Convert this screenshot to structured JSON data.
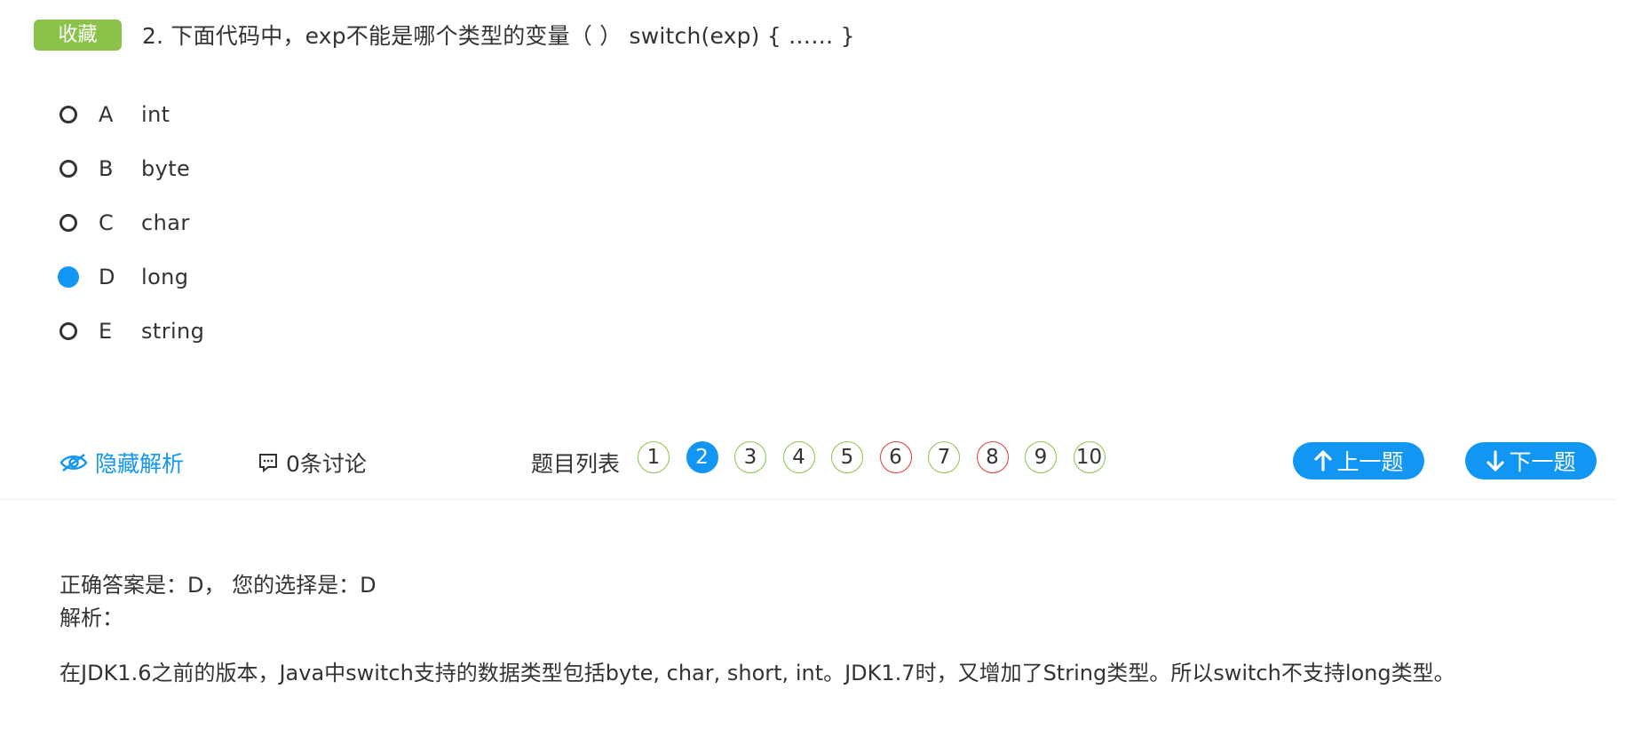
{
  "header": {
    "favorite_label": "收藏",
    "question_title": "2. 下面代码中，exp不能是哪个类型的变量（ ） switch(exp) { …… }"
  },
  "options": [
    {
      "letter": "A",
      "text": "int",
      "selected": false
    },
    {
      "letter": "B",
      "text": "byte",
      "selected": false
    },
    {
      "letter": "C",
      "text": "char",
      "selected": false
    },
    {
      "letter": "D",
      "text": "long",
      "selected": true
    },
    {
      "letter": "E",
      "text": "string",
      "selected": false
    }
  ],
  "toolbar": {
    "hide_analysis_label": "隐藏解析",
    "discussion_label": "0条讨论",
    "question_list_label": "题目列表",
    "question_numbers": [
      {
        "num": "1",
        "status": "correct"
      },
      {
        "num": "2",
        "status": "current"
      },
      {
        "num": "3",
        "status": "correct"
      },
      {
        "num": "4",
        "status": "correct"
      },
      {
        "num": "5",
        "status": "correct"
      },
      {
        "num": "6",
        "status": "wrong"
      },
      {
        "num": "7",
        "status": "correct"
      },
      {
        "num": "8",
        "status": "wrong"
      },
      {
        "num": "9",
        "status": "correct"
      },
      {
        "num": "10",
        "status": "correct"
      }
    ],
    "prev_label": "上一题",
    "next_label": "下一题"
  },
  "analysis": {
    "answer_line": "正确答案是：D， 您的选择是：D",
    "label": "解析：",
    "text": "在JDK1.6之前的版本，Java中switch支持的数据类型包括byte, char, short, int。JDK1.7时，又增加了String类型。所以switch不支持long类型。"
  },
  "colors": {
    "accent": "#1296f4",
    "favorite": "#8bc34a",
    "correct_border": "#8bc34a",
    "wrong_border": "#e53935"
  }
}
